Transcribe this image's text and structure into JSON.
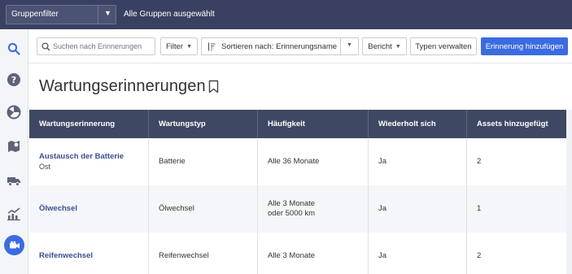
{
  "topbar": {
    "group_filter_label": "Gruppenfilter",
    "group_status": "Alle Gruppen ausgewählt"
  },
  "sidebar": {
    "items": [
      {
        "icon": "search-icon"
      },
      {
        "icon": "help-icon"
      },
      {
        "icon": "pie-chart-icon"
      },
      {
        "icon": "map-icon"
      },
      {
        "icon": "truck-icon"
      },
      {
        "icon": "trend-chart-icon"
      },
      {
        "icon": "video-camera-icon",
        "active": true
      }
    ]
  },
  "toolbar": {
    "search_placeholder": "Suchen nach Erinnerungen",
    "filter_label": "Filter",
    "sort_label": "Sortieren nach:  Erinnerungsname",
    "report_label": "Bericht",
    "types_label": "Typen verwalten",
    "add_label": "Erinnerung hinzufügen"
  },
  "page": {
    "title": "Wartungserinnerungen"
  },
  "table": {
    "columns": [
      "Wartungserinnerung",
      "Wartungstyp",
      "Häufigkeit",
      "Wiederholt sich",
      "Assets hinzugefügt"
    ],
    "rows": [
      {
        "name": "Austausch der Batterie",
        "sub": "Ost",
        "type": "Batterie",
        "freq1": "Alle 36 Monate",
        "freq2": "",
        "repeats": "Ja",
        "assets": "2"
      },
      {
        "name": "Ölwechsel",
        "sub": "",
        "type": "Ölwechsel",
        "freq1": "Alle 3 Monate",
        "freq2": "oder 5000 km",
        "repeats": "Ja",
        "assets": "1"
      },
      {
        "name": "Reifenwechsel",
        "sub": "",
        "type": "Reifenwechsel",
        "freq1": "Alle 3 Monate",
        "freq2": "",
        "repeats": "Ja",
        "assets": "2"
      }
    ]
  },
  "colors": {
    "topbar": "#3a4160",
    "accent": "#3b6be0",
    "table_header": "#3f4862",
    "link": "#3b4f8c"
  }
}
